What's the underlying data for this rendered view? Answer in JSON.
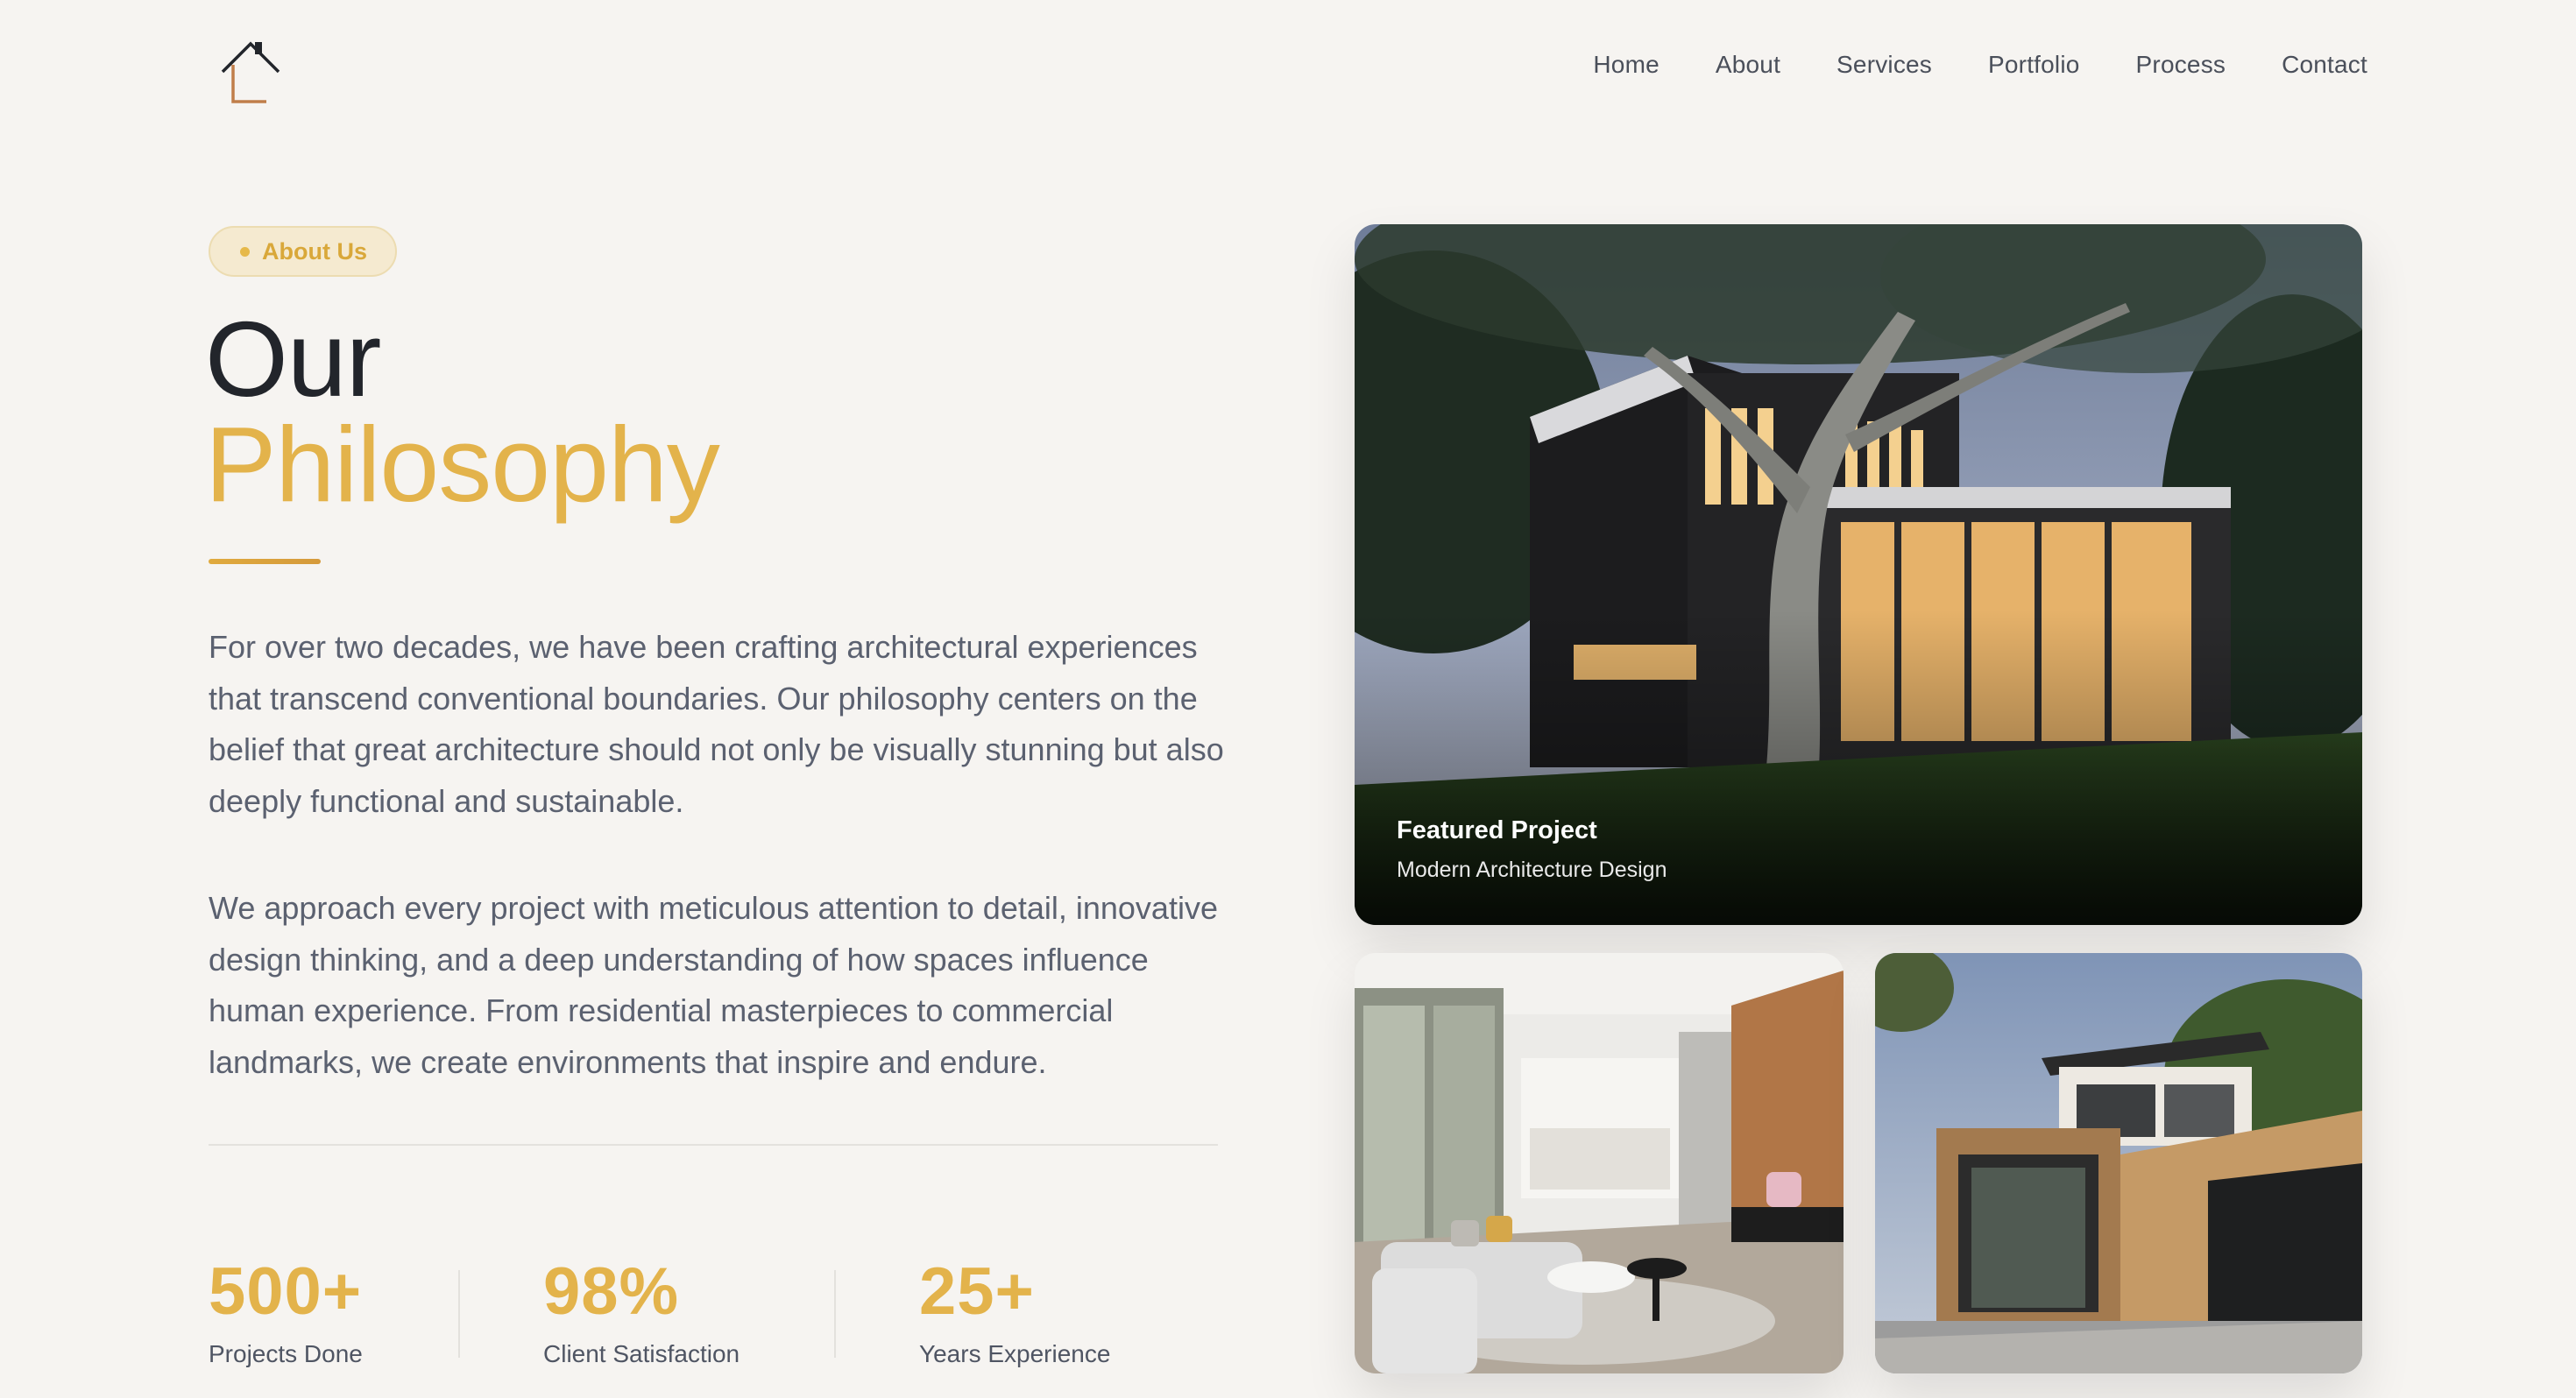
{
  "nav": {
    "logo_icon": "house-icon",
    "links": [
      "Home",
      "About",
      "Services",
      "Portfolio",
      "Process",
      "Contact"
    ]
  },
  "hero": {
    "badge": "About Us",
    "title_line1": "Our",
    "title_line2": "Philosophy",
    "paragraph1": "For over two decades, we have been crafting architectural experiences that transcend conventional boundaries. Our philosophy centers on the belief that great architecture should not only be visually stunning but also deeply functional and sustainable.",
    "paragraph2": "We approach every project with meticulous attention to detail, innovative design thinking, and a deep understanding of how spaces influence human experience. From residential masterpieces to commercial landmarks, we create environments that inspire and endure."
  },
  "stats": [
    {
      "value": "500+",
      "label": "Projects Done"
    },
    {
      "value": "98%",
      "label": "Client Satisfaction"
    },
    {
      "value": "25+",
      "label": "Years Experience"
    }
  ],
  "featured": {
    "title": "Featured Project",
    "subtitle": "Modern Architecture Design"
  },
  "colors": {
    "accent": "#e3b34b",
    "background": "#f6f4f1",
    "text": "#22252b"
  }
}
